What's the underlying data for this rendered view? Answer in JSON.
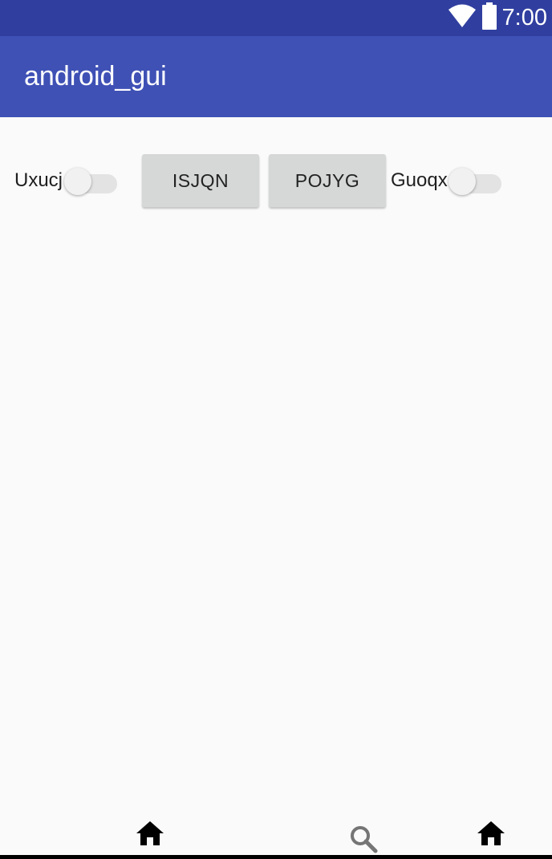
{
  "status_bar": {
    "time": "7:00",
    "icons": [
      "wifi-icon",
      "battery-icon"
    ],
    "color": "#303f9f"
  },
  "app_bar": {
    "title": "android_gui",
    "color": "#3f51b5"
  },
  "controls": {
    "switch_1": {
      "label": "Uxucj",
      "checked": false
    },
    "button_1": {
      "label": "ISJQN"
    },
    "button_2": {
      "label": "POJYG"
    },
    "switch_2": {
      "label": "Guoqx",
      "checked": false
    }
  },
  "bottom_nav": {
    "icons": [
      "home-icon",
      "search-icon",
      "home-icon"
    ]
  }
}
